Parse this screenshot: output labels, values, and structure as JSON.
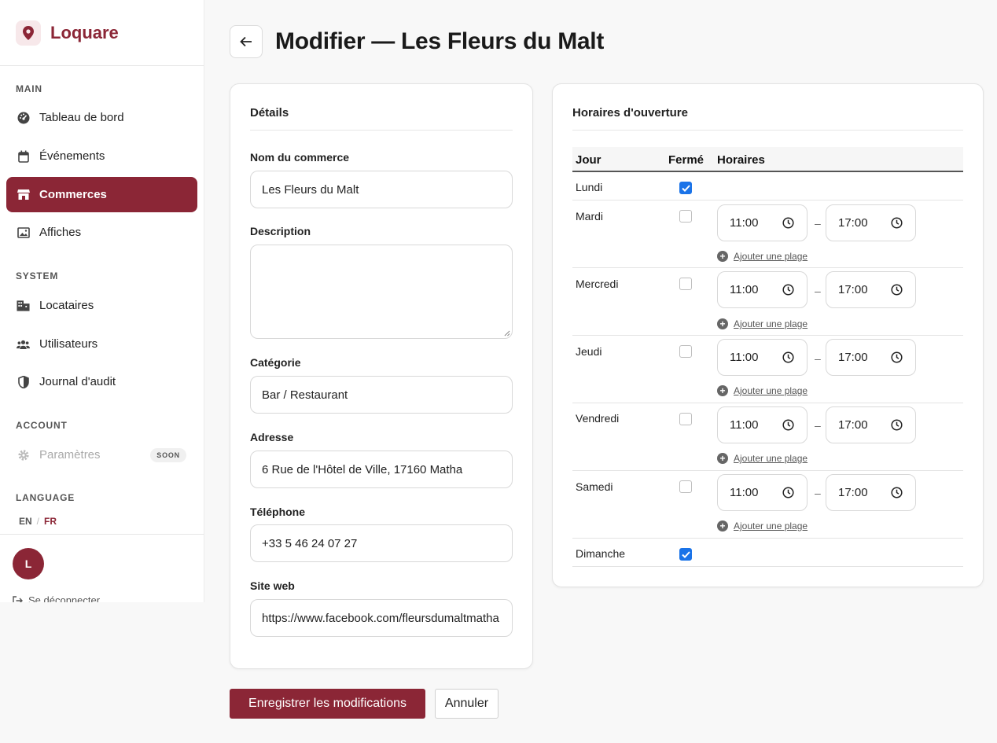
{
  "brand": {
    "name": "Loquare",
    "accent": "#8b2636"
  },
  "sidebar": {
    "sections": [
      {
        "label": "MAIN"
      },
      {
        "label": "SYSTEM"
      },
      {
        "label": "ACCOUNT"
      },
      {
        "label": "LANGUAGE"
      }
    ],
    "items": [
      {
        "label": "Tableau de bord",
        "icon": "dashboard-icon"
      },
      {
        "label": "Événements",
        "icon": "calendar-icon"
      },
      {
        "label": "Commerces",
        "icon": "store-icon",
        "active": true
      },
      {
        "label": "Affiches",
        "icon": "image-icon"
      },
      {
        "label": "Locataires",
        "icon": "building-icon"
      },
      {
        "label": "Utilisateurs",
        "icon": "users-icon"
      },
      {
        "label": "Journal d'audit",
        "icon": "shield-icon"
      },
      {
        "label": "Paramètres",
        "icon": "gear-icon",
        "disabled": true,
        "badge": "SOON"
      }
    ],
    "languages": [
      "EN",
      "FR"
    ],
    "active_language": "FR",
    "user_initial": "L",
    "logout_label": "Se déconnecter"
  },
  "header": {
    "title": "Modifier — Les Fleurs du Malt"
  },
  "details": {
    "title": "Détails",
    "name_label": "Nom du commerce",
    "name_value": "Les Fleurs du Malt",
    "description_label": "Description",
    "description_value": "",
    "category_label": "Catégorie",
    "category_value": "Bar / Restaurant",
    "address_label": "Adresse",
    "address_value": "6 Rue de l'Hôtel de Ville, 17160 Matha",
    "phone_label": "Téléphone",
    "phone_value": "+33 5 46 24 07 27",
    "website_label": "Site web",
    "website_value": "https://www.facebook.com/fleursdumaltmatha"
  },
  "hours": {
    "title": "Horaires d'ouverture",
    "col_day": "Jour",
    "col_closed": "Fermé",
    "col_hours": "Horaires",
    "separator": "–",
    "add_range_label": "Ajouter une plage",
    "days": [
      {
        "day": "Lundi",
        "closed": true
      },
      {
        "day": "Mardi",
        "closed": false,
        "open": "11:00",
        "close": "17:00"
      },
      {
        "day": "Mercredi",
        "closed": false,
        "open": "11:00",
        "close": "17:00"
      },
      {
        "day": "Jeudi",
        "closed": false,
        "open": "11:00",
        "close": "17:00"
      },
      {
        "day": "Vendredi",
        "closed": false,
        "open": "11:00",
        "close": "17:00"
      },
      {
        "day": "Samedi",
        "closed": false,
        "open": "11:00",
        "close": "17:00"
      },
      {
        "day": "Dimanche",
        "closed": true
      }
    ]
  },
  "actions": {
    "save_label": "Enregistrer les modifications",
    "cancel_label": "Annuler"
  }
}
